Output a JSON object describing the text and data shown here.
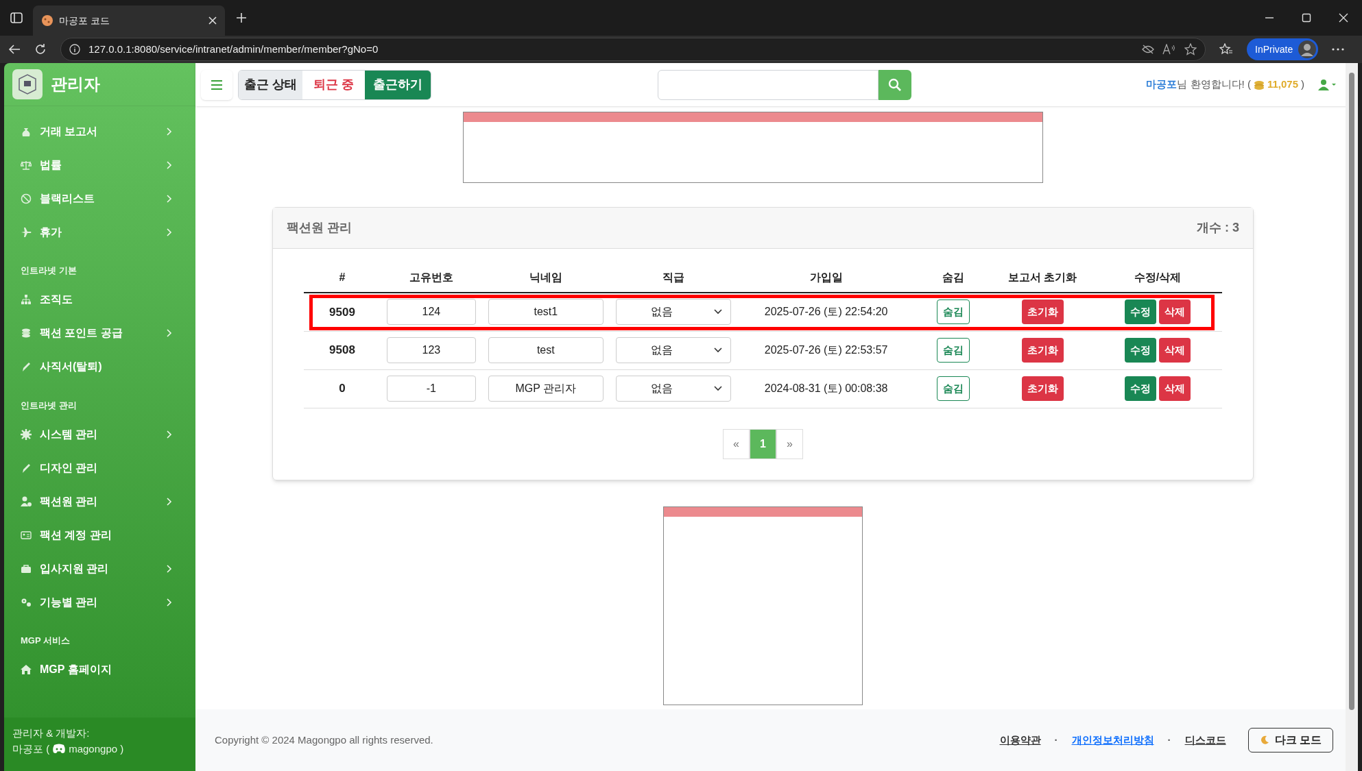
{
  "browser": {
    "tab_title": "마공포 코드",
    "url": "127.0.0.1:8080/service/intranet/admin/member/member?gNo=0",
    "profile": "InPrivate"
  },
  "sidebar": {
    "title": "관리자",
    "sections": [
      {
        "items": [
          {
            "label": "거래 보고서",
            "expandable": true
          },
          {
            "label": "법률",
            "expandable": true
          },
          {
            "label": "블랙리스트",
            "expandable": true
          },
          {
            "label": "휴가",
            "expandable": true
          }
        ]
      },
      {
        "heading": "인트라넷 기본",
        "items": [
          {
            "label": "조직도",
            "expandable": false
          },
          {
            "label": "팩션 포인트 공급",
            "expandable": true
          },
          {
            "label": "사직서(탈퇴)",
            "expandable": false
          }
        ]
      },
      {
        "heading": "인트라넷 관리",
        "items": [
          {
            "label": "시스템 관리",
            "expandable": true
          },
          {
            "label": "디자인 관리",
            "expandable": false
          },
          {
            "label": "팩션원 관리",
            "expandable": true
          },
          {
            "label": "팩션 계정 관리",
            "expandable": false
          },
          {
            "label": "입사지원 관리",
            "expandable": true
          },
          {
            "label": "기능별 관리",
            "expandable": true
          }
        ]
      },
      {
        "heading": "MGP 서비스",
        "items": [
          {
            "label": "MGP 홈페이지",
            "expandable": false
          }
        ]
      }
    ],
    "footer_label": "관리자 & 개발자:",
    "footer_name": "마공포 (",
    "footer_handle": "magongpo )"
  },
  "header": {
    "status_label": "출근 상태",
    "status_value": "퇴근 중",
    "checkin_button": "출근하기",
    "welcome_name": "마공포",
    "welcome_text": "님 환영합니다! (",
    "points": "11,075",
    "points_close": ")"
  },
  "card": {
    "title": "팩션원 관리",
    "count": "개수 : 3",
    "columns": [
      "#",
      "고유번호",
      "닉네임",
      "직급",
      "가입일",
      "숨김",
      "보고서 초기화",
      "수정/삭제"
    ],
    "rows": [
      {
        "no": "9509",
        "uid": "124",
        "nickname": "test1",
        "rank": "없음",
        "joined": "2025-07-26 (토) 22:54:20",
        "hide": "숨김",
        "reset": "초기화",
        "edit": "수정",
        "delete": "삭제",
        "highlighted": true
      },
      {
        "no": "9508",
        "uid": "123",
        "nickname": "test",
        "rank": "없음",
        "joined": "2025-07-26 (토) 22:53:57",
        "hide": "숨김",
        "reset": "초기화",
        "edit": "수정",
        "delete": "삭제",
        "highlighted": false
      },
      {
        "no": "0",
        "uid": "-1",
        "nickname": "MGP 관리자",
        "rank": "없음",
        "joined": "2024-08-31 (토) 00:08:38",
        "hide": "숨김",
        "reset": "초기화",
        "edit": "수정",
        "delete": "삭제",
        "highlighted": false
      }
    ],
    "pagination": [
      {
        "label": "«",
        "selected": false
      },
      {
        "label": "1",
        "selected": true
      },
      {
        "label": "»",
        "selected": false
      }
    ]
  },
  "footer": {
    "copyright": "Copyright © 2024 Magongpo all rights reserved.",
    "links": [
      {
        "label": "이용약관",
        "color": "#333333"
      },
      {
        "label": "개인정보처리방침",
        "color": "#0d6efd"
      },
      {
        "label": "디스코드",
        "color": "#333333"
      }
    ],
    "separator": "·",
    "dark_mode": "다크 모드"
  }
}
